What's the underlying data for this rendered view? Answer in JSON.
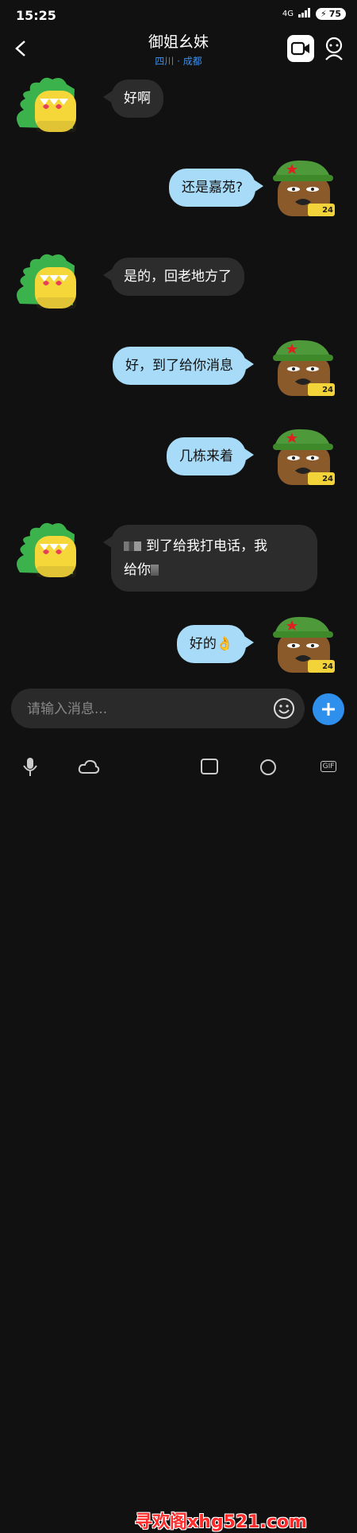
{
  "status": {
    "time": "15:25",
    "network": "4G",
    "battery": "75"
  },
  "header": {
    "title": "御姐幺妹",
    "subtitle": "四川 · 成都"
  },
  "messages": [
    {
      "side": "left",
      "text": "好啊"
    },
    {
      "side": "right",
      "text": "还是嘉苑?"
    },
    {
      "side": "left",
      "text": "是的，回老地方了"
    },
    {
      "side": "right",
      "text": "好，到了给你消息"
    },
    {
      "side": "right",
      "text": "几栋来着"
    },
    {
      "side": "left",
      "text_a": "到了给我打电话，我",
      "text_b": "给你"
    },
    {
      "side": "right",
      "text": "好的👌"
    }
  ],
  "avatar_badge": "24",
  "composer": {
    "placeholder": "请输入消息..."
  },
  "toolbar": {
    "gif": "GIF"
  },
  "watermark": "寻欢阁xhg521.com",
  "colors": {
    "bubble_right": "#a7dbf7",
    "bubble_left": "#2c2c2c",
    "accent": "#2f8fec"
  }
}
